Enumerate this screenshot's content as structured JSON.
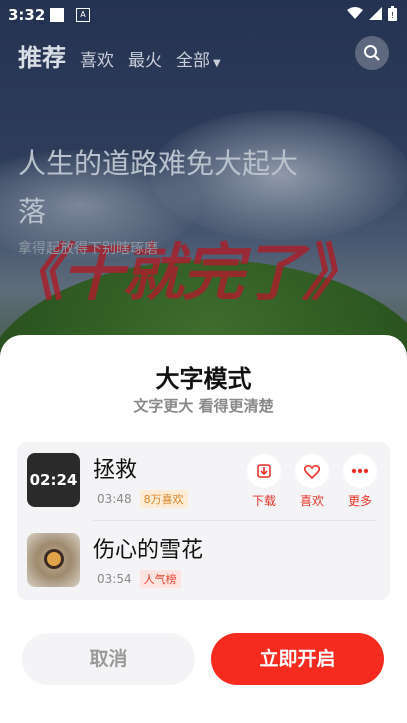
{
  "status_bar": {
    "time": "3:32"
  },
  "nav": {
    "tabs": [
      {
        "label": "推荐"
      },
      {
        "label": "喜欢"
      },
      {
        "label": "最火"
      },
      {
        "label": "全部"
      }
    ]
  },
  "background": {
    "headline": "人生的道路难免大起大落",
    "subline": "拿得起放得下别瞎琢磨",
    "title_art": "《干就完了》"
  },
  "sheet": {
    "title": "大字模式",
    "subtitle": "文字更大 看得更清楚",
    "songs": [
      {
        "name": "拯救",
        "thumb_text": "02:24",
        "duration": "03:48",
        "badge": "8万喜欢"
      },
      {
        "name": "伤心的雪花",
        "duration": "03:54",
        "badge": "人气榜"
      }
    ],
    "actions": [
      {
        "label": "下载",
        "icon": "download-icon"
      },
      {
        "label": "喜欢",
        "icon": "heart-icon"
      },
      {
        "label": "更多",
        "icon": "more-icon"
      }
    ],
    "cancel_label": "取消",
    "confirm_label": "立即开启"
  },
  "colors": {
    "accent": "#f62b20",
    "badge_orange": "#d6852a",
    "badge_red": "#e8432f"
  }
}
